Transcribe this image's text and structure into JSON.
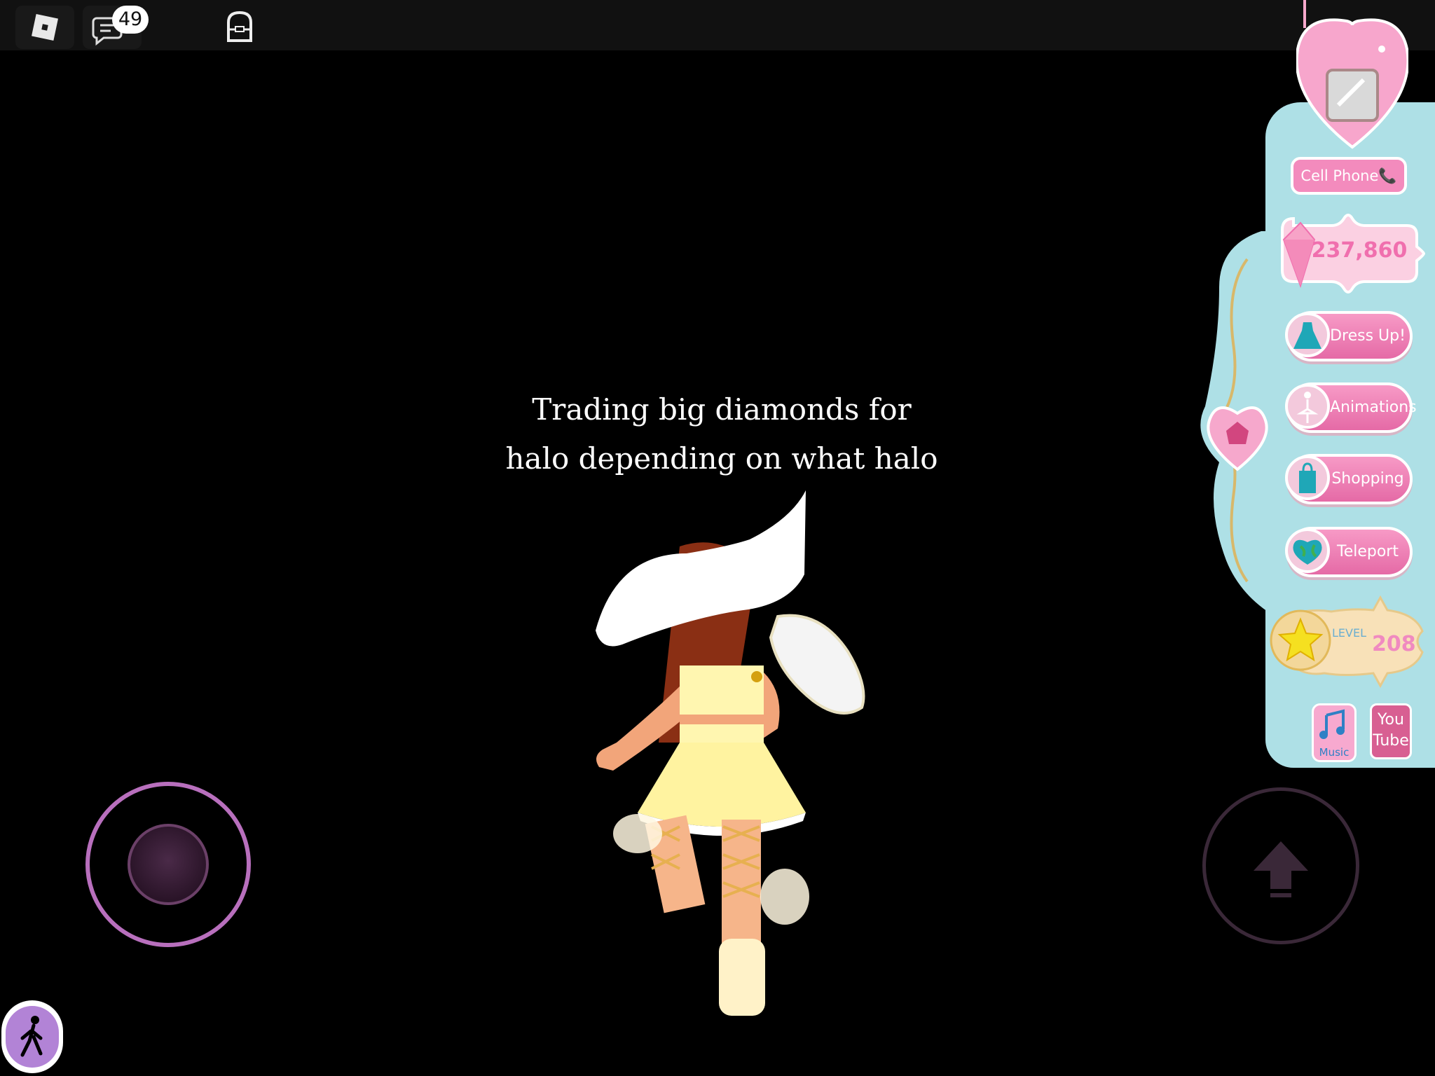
{
  "topbar": {
    "roblox_icon": "roblox-logo-icon",
    "chat_icon": "chat-icon",
    "chat_badge": "49",
    "backpack_icon": "backpack-icon"
  },
  "caption": {
    "line1": "Trading big diamonds for",
    "line2": "halo depending on what halo"
  },
  "sidebar": {
    "phone_icon": "heart-phone-icon",
    "cell_phone_label": "Cell Phone📞",
    "diamonds_value": "237,860",
    "buttons": [
      {
        "label": "Dress Up!",
        "icon": "dress-icon"
      },
      {
        "label": "Animations",
        "icon": "ballerina-icon"
      },
      {
        "label": "Shopping",
        "icon": "shopping-bag-icon"
      },
      {
        "label": "Teleport",
        "icon": "globe-heart-icon"
      }
    ],
    "level_label": "LEVEL",
    "level_value": "208",
    "music_label": "Music",
    "youtube_label_1": "You",
    "youtube_label_2": "Tube"
  },
  "controls": {
    "joystick": "thumbstick",
    "jump_icon": "jump-arrow-icon",
    "walk_icon": "walk-person-icon"
  },
  "colors": {
    "panel": "#aee0e6",
    "pink": "#f38bbd",
    "joystick_ring": "#b86fbd"
  }
}
